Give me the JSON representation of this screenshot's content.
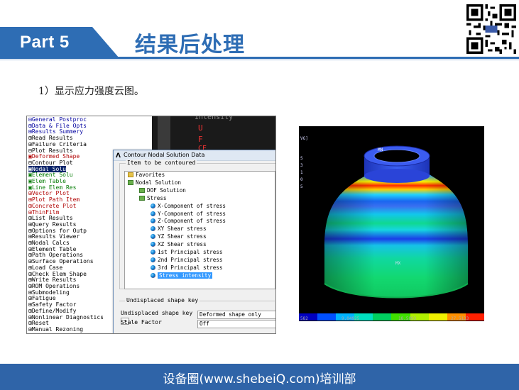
{
  "header": {
    "part_label": "Part 5",
    "title": "结果后处理",
    "accent_color": "#2e6db4"
  },
  "caption": "1）显示应力强度云图。",
  "ansys_tree": {
    "items": [
      {
        "label": "⊟General Postproc",
        "style": "blue"
      },
      {
        "label": "  ⊞Data & File Opts",
        "style": "blue"
      },
      {
        "label": "  ⊞Results Summery",
        "style": "blue"
      },
      {
        "label": "  ⊞Read Results",
        "style": ""
      },
      {
        "label": "  ⊞Failure Criteria",
        "style": ""
      },
      {
        "label": "  ⊟Plot Results",
        "style": ""
      },
      {
        "label": "    ▣Deformed Shape",
        "style": "red"
      },
      {
        "label": "    ⊟Contour Plot",
        "style": ""
      },
      {
        "label": "      ▣Nodal Solu",
        "style": "hl"
      },
      {
        "label": "      ▣Element Solu",
        "style": "green"
      },
      {
        "label": "      ▣Elem Table",
        "style": "green"
      },
      {
        "label": "      ▣Line Elem Res",
        "style": "green"
      },
      {
        "label": "    ⊞Vector Plot",
        "style": "red"
      },
      {
        "label": "    ⊞Plot Path Item",
        "style": "red"
      },
      {
        "label": "    ⊞Concrete Plot",
        "style": "red"
      },
      {
        "label": "    ⊞ThinFilm",
        "style": "red"
      },
      {
        "label": "  ⊞List Results",
        "style": ""
      },
      {
        "label": "  ⊞Query Results",
        "style": ""
      },
      {
        "label": "  ⊞Options for Outp",
        "style": ""
      },
      {
        "label": "  ⊞Results Viewer",
        "style": ""
      },
      {
        "label": "  ⊞Nodal Calcs",
        "style": ""
      },
      {
        "label": "  ⊞Element Table",
        "style": ""
      },
      {
        "label": "  ⊞Path Operations",
        "style": ""
      },
      {
        "label": "  ⊞Surface Operations",
        "style": ""
      },
      {
        "label": "  ⊞Load Case",
        "style": ""
      },
      {
        "label": "  ⊞Check Elem Shape",
        "style": ""
      },
      {
        "label": "  ⊞Write Results",
        "style": ""
      },
      {
        "label": "  ⊞ROM Operations",
        "style": ""
      },
      {
        "label": "  ⊞Submodeling",
        "style": ""
      },
      {
        "label": "  ⊞Fatigue",
        "style": ""
      },
      {
        "label": "  ⊞Safety Factor",
        "style": ""
      },
      {
        "label": "  ⊞Define/Modify",
        "style": ""
      },
      {
        "label": "  ⊞Nonlinear Diagnostics",
        "style": ""
      },
      {
        "label": "  ⊞Reset",
        "style": ""
      },
      {
        "label": "  ⊞Manual Rezoning",
        "style": ""
      }
    ]
  },
  "background_panel": {
    "top_text": "Intensity",
    "letters": [
      "U",
      "F",
      "CE"
    ]
  },
  "dialog": {
    "title": "Contour Nodal Solution Data",
    "logo": "Λ",
    "group_label": "Item to be contoured",
    "list": [
      {
        "label": "Favorites",
        "icon": "folder",
        "indent": 0,
        "selected": false
      },
      {
        "label": "Nodal Solution",
        "icon": "fold2",
        "indent": 0,
        "selected": false
      },
      {
        "label": "DOF Solution",
        "icon": "fold2",
        "indent": 1,
        "selected": false
      },
      {
        "label": "Stress",
        "icon": "fold2",
        "indent": 1,
        "selected": false
      },
      {
        "label": "X-Component of stress",
        "icon": "ball",
        "indent": 2,
        "selected": false
      },
      {
        "label": "Y-Component of stress",
        "icon": "ball",
        "indent": 2,
        "selected": false
      },
      {
        "label": "Z-Component of stress",
        "icon": "ball",
        "indent": 2,
        "selected": false
      },
      {
        "label": "XY Shear stress",
        "icon": "ball",
        "indent": 2,
        "selected": false
      },
      {
        "label": "YZ Shear stress",
        "icon": "ball",
        "indent": 2,
        "selected": false
      },
      {
        "label": "XZ Shear stress",
        "icon": "ball",
        "indent": 2,
        "selected": false
      },
      {
        "label": "1st Principal stress",
        "icon": "ball",
        "indent": 2,
        "selected": false
      },
      {
        "label": "2nd Principal stress",
        "icon": "ball",
        "indent": 2,
        "selected": false
      },
      {
        "label": "3rd Principal stress",
        "icon": "ball",
        "indent": 2,
        "selected": false
      },
      {
        "label": "Stress intensity",
        "icon": "ball",
        "indent": 2,
        "selected": true
      }
    ],
    "scroll_glyph": "◂",
    "group2_label": "Undisplaced shape key",
    "undisplaced_label": "Undisplaced shape key",
    "undisplaced_value": "Deformed shape only",
    "scale_label": "Scale Factor",
    "scale_value": "Off"
  },
  "result_view": {
    "side_text": [
      "VG]",
      "S",
      "3",
      "1",
      "0",
      "5"
    ],
    "node_label": "MN",
    "axis_label": "MX",
    "legend_colors": [
      "#0000c0",
      "#0050ff",
      "#00b4ff",
      "#00e0c0",
      "#00d060",
      "#40e000",
      "#b0f000",
      "#f0f000",
      "#ff9000",
      "#ff2000"
    ],
    "legend_values": [
      "582",
      "9.04925",
      "18.5093",
      "27.5133"
    ]
  },
  "footer": "设备圈(www.shebeiQ.com)培训部"
}
